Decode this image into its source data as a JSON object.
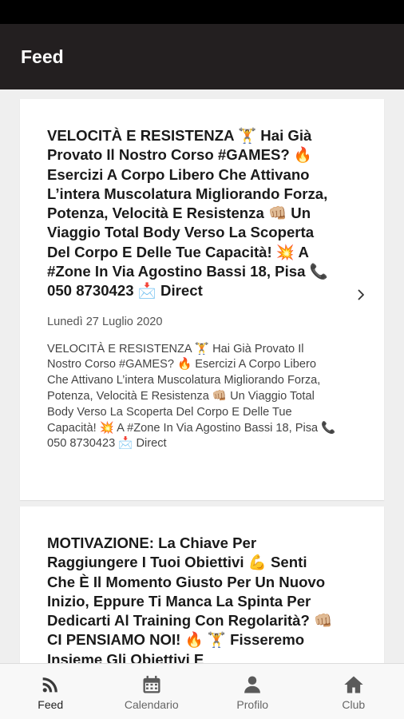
{
  "app_bar": {
    "title": "Feed"
  },
  "posts": [
    {
      "title": "VELOCITÀ E RESISTENZA 🏋️ Hai Già Provato Il Nostro Corso #GAMES? 🔥 Esercizi A Corpo Libero Che Attivano L’intera Muscolatura Migliorando Forza, Potenza, Velocità E Resistenza 👊🏼 Un Viaggio Total Body Verso La Scoperta Del Corpo E Delle Tue Capacità! 💥 A #Zone In Via Agostino Bassi 18, Pisa 📞 050 8730423 📩 Direct",
      "date": "Lunedì 27 Luglio 2020",
      "description": "VELOCITÀ E RESISTENZA 🏋️ Hai Già Provato Il Nostro Corso #GAMES? 🔥 Esercizi A Corpo Libero Che Attivano L’intera Muscolatura Migliorando Forza, Potenza, Velocità E Resistenza 👊🏼 Un Viaggio Total Body Verso La Scoperta Del Corpo E Delle Tue Capacità! 💥 A #Zone In Via Agostino Bassi 18, Pisa 📞 050 8730423 📩 Direct"
    },
    {
      "title": "MOTIVAZIONE: La Chiave Per Raggiungere I Tuoi Obiettivi 💪 Senti Che È Il Momento Giusto Per Un Nuovo Inizio, Eppure Ti Manca La Spinta Per Dedicarti Al Training Con Regolarità? 👊🏼 CI PENSIAMO NOI! 🔥 🏋️ Fisseremo Insieme Gli Obiettivi E"
    }
  ],
  "bottom_nav": {
    "items": [
      {
        "label": "Feed",
        "icon": "rss-feed-icon",
        "active": true
      },
      {
        "label": "Calendario",
        "icon": "calendar-icon",
        "active": false
      },
      {
        "label": "Profilo",
        "icon": "person-icon",
        "active": false
      },
      {
        "label": "Club",
        "icon": "home-icon",
        "active": false
      }
    ]
  },
  "colors": {
    "app_bar": "#231f20",
    "background": "#efefef",
    "card": "#ffffff",
    "nav_icon": "#5a5a5a"
  }
}
